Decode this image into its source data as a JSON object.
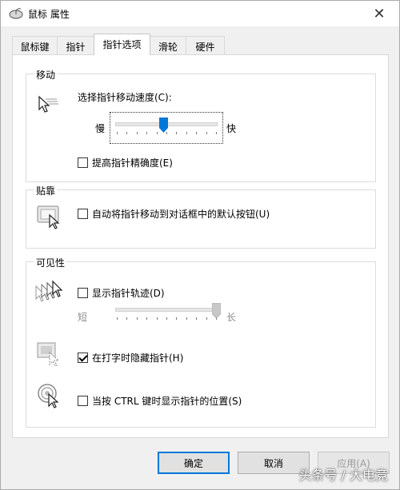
{
  "window": {
    "title": "鼠标 属性",
    "close_glyph": "✕"
  },
  "tabs": [
    {
      "label": "鼠标键",
      "active": false
    },
    {
      "label": "指针",
      "active": false
    },
    {
      "label": "指针选项",
      "active": true
    },
    {
      "label": "滑轮",
      "active": false
    },
    {
      "label": "硬件",
      "active": false
    }
  ],
  "motion": {
    "title": "移动",
    "speed_label": "选择指针移动速度(C):",
    "slow_label": "慢",
    "fast_label": "快",
    "speed_level": 0.47,
    "precision_label": "提高指针精确度(E)",
    "precision_checked": false
  },
  "snap": {
    "title": "贴靠",
    "snap_label": "自动将指针移动到对话框中的默认按钮(U)",
    "snap_checked": false
  },
  "visibility": {
    "title": "可见性",
    "trails_label": "显示指针轨迹(D)",
    "trails_checked": false,
    "short_label": "短",
    "long_label": "长",
    "trails_level": 1.0,
    "hide_label": "在打字时隐藏指针(H)",
    "hide_checked": true,
    "ctrl_label": "当按 CTRL 键时显示指针的位置(S)",
    "ctrl_checked": false
  },
  "buttons": {
    "ok": "确定",
    "cancel": "取消",
    "apply": "应用(A)"
  },
  "watermark": "头条号 / 大电竞",
  "colors": {
    "accent": "#0078d7",
    "focus_border": "#0078d7"
  },
  "icons": {
    "title": "mouse-icon",
    "motion": "pointer-speed-icon",
    "snap": "snap-to-icon",
    "trails": "pointer-trails-icon",
    "hide": "hide-pointer-icon",
    "ctrl": "ctrl-locate-icon"
  }
}
